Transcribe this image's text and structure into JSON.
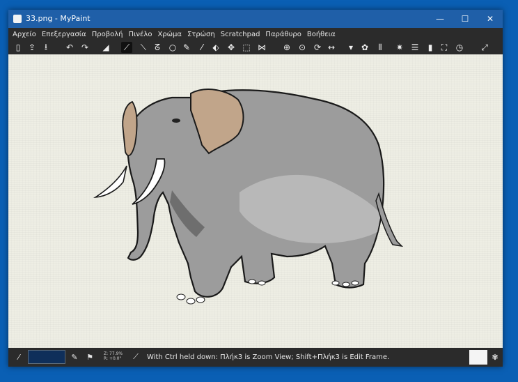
{
  "window": {
    "title": "33.png - MyPaint",
    "controls": {
      "minimize": "—",
      "maximize": "☐",
      "close": "✕"
    }
  },
  "menu": {
    "items": [
      "Αρχείο",
      "Επεξεργασία",
      "Προβολή",
      "Πινέλο",
      "Χρώμα",
      "Στρώση",
      "Scratchpad",
      "Παράθυρο",
      "Βοήθεια"
    ]
  },
  "toolbar": {
    "icons": [
      {
        "name": "new-document-icon",
        "glyph": "▯"
      },
      {
        "name": "open-document-icon",
        "glyph": "⇪"
      },
      {
        "name": "save-icon",
        "glyph": "⭳"
      },
      {
        "name": "undo-icon",
        "glyph": "↶"
      },
      {
        "name": "redo-icon",
        "glyph": "↷"
      },
      {
        "name": "eraser-icon",
        "glyph": "◢"
      },
      {
        "name": "freehand-brush-icon",
        "glyph": "⟋",
        "active": true
      },
      {
        "name": "lines-curves-icon",
        "glyph": "⟍"
      },
      {
        "name": "connected-lines-icon",
        "glyph": "ᘔ"
      },
      {
        "name": "ellipse-icon",
        "glyph": "○"
      },
      {
        "name": "inking-icon",
        "glyph": "✎"
      },
      {
        "name": "color-picker-icon",
        "glyph": "⁄"
      },
      {
        "name": "flood-fill-icon",
        "glyph": "⬖"
      },
      {
        "name": "pan-view-icon",
        "glyph": "✥"
      },
      {
        "name": "edit-frame-icon",
        "glyph": "⬚"
      },
      {
        "name": "symmetry-icon",
        "glyph": "⋈"
      },
      {
        "name": "move-icon",
        "glyph": "⊕"
      },
      {
        "name": "zoom-icon",
        "glyph": "⊙"
      },
      {
        "name": "rotate-icon",
        "glyph": "⟳"
      },
      {
        "name": "mirror-icon",
        "glyph": "↔"
      },
      {
        "name": "dropdown-arrow-icon",
        "glyph": "▾"
      },
      {
        "name": "color-wheel-icon",
        "glyph": "✿"
      },
      {
        "name": "brush-groups-icon",
        "glyph": "⫴"
      },
      {
        "name": "settings-icon",
        "glyph": "✷"
      },
      {
        "name": "layers-icon",
        "glyph": "☰"
      },
      {
        "name": "scratchpad-icon",
        "glyph": "▮"
      },
      {
        "name": "fullscreen-icon",
        "glyph": "⛶"
      },
      {
        "name": "history-icon",
        "glyph": "◷"
      },
      {
        "name": "expand-icon",
        "glyph": "⤢"
      }
    ]
  },
  "status": {
    "zoom": "Z: 77.9%",
    "rotation": "R: +0.0°",
    "message": "With Ctrl held down:  Πλήκ3 is Zoom View;  Shift+Πλήκ3 is Edit Frame."
  },
  "colors": {
    "titlebar": "#1f5fa8",
    "chrome": "#2b2b2b",
    "canvas": "#eeeee4",
    "current_color": "#0f2f5a",
    "elephant_body": "#9c9c9c",
    "elephant_ear": "#c1a58a",
    "elephant_tusk": "#ffffff"
  }
}
